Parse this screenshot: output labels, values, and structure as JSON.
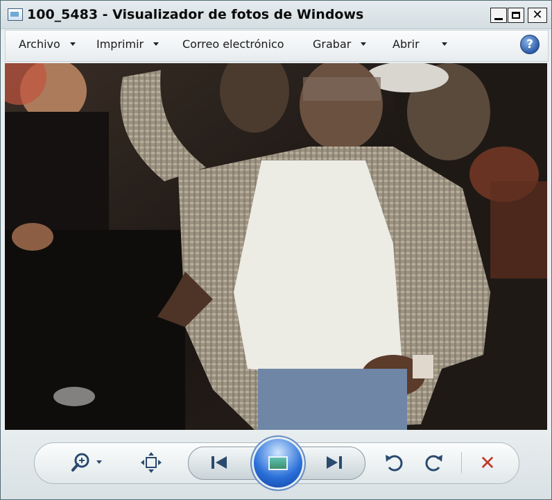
{
  "window": {
    "title": "100_5483 - Visualizador de fotos de Windows",
    "minimize_icon": "minimize-icon",
    "maximize_icon": "maximize-icon",
    "close_icon": "close-icon"
  },
  "menu": {
    "items": [
      {
        "label": "Archivo",
        "has_dropdown": true
      },
      {
        "label": "Imprimir",
        "has_dropdown": true
      },
      {
        "label": "Correo electrónico",
        "has_dropdown": false
      },
      {
        "label": "Grabar",
        "has_dropdown": true
      },
      {
        "label": "Abrir",
        "has_dropdown": true
      }
    ],
    "help_icon": "help-icon"
  },
  "photo": {
    "description_icon": "photo-image"
  },
  "controls": {
    "zoom_icon": "magnifier-zoom-icon",
    "fit_icon": "actual-size-icon",
    "previous_icon": "previous-icon",
    "slideshow_icon": "slideshow-icon",
    "next_icon": "next-icon",
    "rotate_ccw_icon": "rotate-counterclockwise-icon",
    "rotate_cw_icon": "rotate-clockwise-icon",
    "delete_icon": "delete-icon"
  },
  "colors": {
    "accent_blue": "#2a6fd8",
    "delete_red": "#c0392b",
    "chrome": "#e9eef0"
  }
}
